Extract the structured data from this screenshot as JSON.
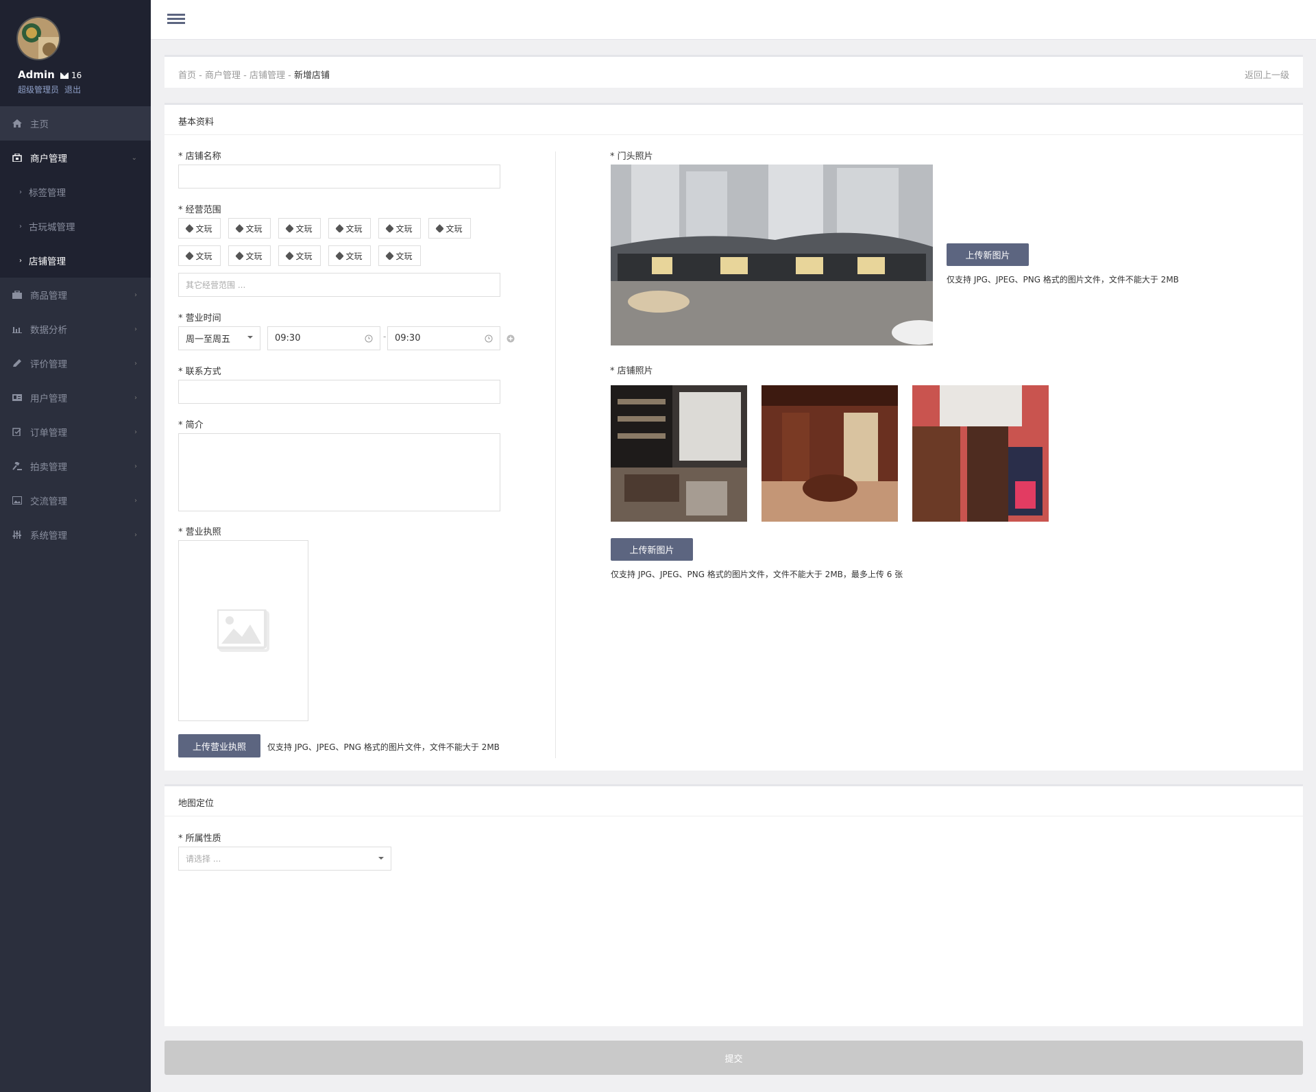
{
  "profile": {
    "name": "Admin",
    "mail_count": "16",
    "role": "超级管理员",
    "logout": "退出"
  },
  "nav": {
    "home": "主页",
    "merchant": "商户管理",
    "merchant_sub": [
      "标签管理",
      "古玩城管理",
      "店铺管理"
    ],
    "goods": "商品管理",
    "analytics": "数据分析",
    "reviews": "评价管理",
    "users": "用户管理",
    "orders": "订单管理",
    "auction": "拍卖管理",
    "exchange": "交流管理",
    "system": "系统管理"
  },
  "breadcrumb": {
    "items": [
      "首页",
      "商户管理",
      "店铺管理"
    ],
    "separator": " - ",
    "current": "新增店铺",
    "back": "返回上一级"
  },
  "basic": {
    "title": "基本资料",
    "shop_name_label": "店铺名称",
    "scope_label": "经营范围",
    "scope_tags": [
      "文玩",
      "文玩",
      "文玩",
      "文玩",
      "文玩",
      "文玩",
      "文玩",
      "文玩",
      "文玩",
      "文玩",
      "文玩"
    ],
    "scope_other_placeholder": "其它经营范围 ...",
    "hours_label": "营业时间",
    "hours_days": "周一至周五",
    "hours_start": "09:30",
    "hours_sep": "-",
    "hours_end": "09:30",
    "contact_label": "联系方式",
    "intro_label": "简介",
    "license_label": "营业执照",
    "license_button": "上传营业执照",
    "license_hint": "仅支持 JPG、JPEG、PNG 格式的图片文件，文件不能大于 2MB",
    "front_photo_label": "门头照片",
    "front_upload_button": "上传新图片",
    "front_hint": "仅支持 JPG、JPEG、PNG 格式的图片文件，文件不能大于 2MB",
    "shop_photos_label": "店铺照片",
    "shop_upload_button": "上传新图片",
    "shop_hint": "仅支持 JPG、JPEG、PNG 格式的图片文件，文件不能大于 2MB，最多上传 6 张"
  },
  "map": {
    "title": "地图定位",
    "nature_label": "所属性质",
    "nature_placeholder": "请选择 ..."
  },
  "submit": "提交",
  "colors": {
    "sidebar": "#2b2f3d",
    "sidebar_dark": "#1f2230",
    "accent": "#5c6580",
    "submit_disabled": "#c9c9c9"
  },
  "icons": [
    "menu-icon",
    "home-icon",
    "shop-icon",
    "briefcase-icon",
    "bar-chart-icon",
    "pencil-icon",
    "id-card-icon",
    "clipboard-icon",
    "gavel-icon",
    "image-icon",
    "sliders-icon",
    "clock-icon",
    "plus-circle-icon",
    "tag-icon",
    "envelope-icon"
  ]
}
